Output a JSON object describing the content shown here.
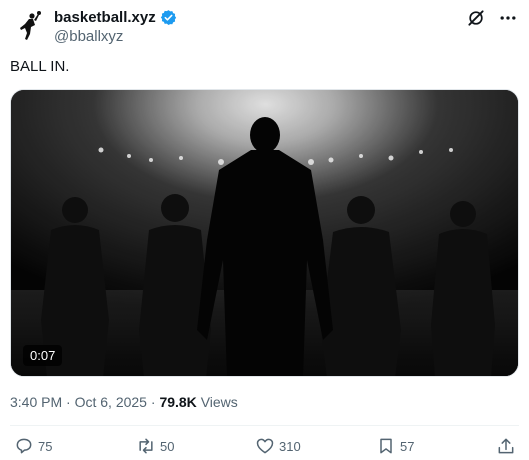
{
  "post": {
    "display_name": "basketball.xyz",
    "handle": "@bballxyz",
    "text": "BALL IN.",
    "media": {
      "duration": "0:07"
    },
    "time": "3:40 PM",
    "date": "Oct 6, 2025",
    "views_count": "79.8K",
    "views_label": "Views",
    "sep": "·"
  },
  "actions": {
    "reply": "75",
    "repost": "50",
    "like": "310",
    "bookmark": "57"
  },
  "colors": {
    "verified": "#1d9bf0",
    "muted": "#536471",
    "text": "#0f1419"
  },
  "icons": [
    "avatar-logo-icon",
    "verified-badge-icon",
    "grok-icon",
    "more-icon",
    "reply-icon",
    "repost-icon",
    "like-icon",
    "bookmark-icon",
    "share-icon"
  ]
}
